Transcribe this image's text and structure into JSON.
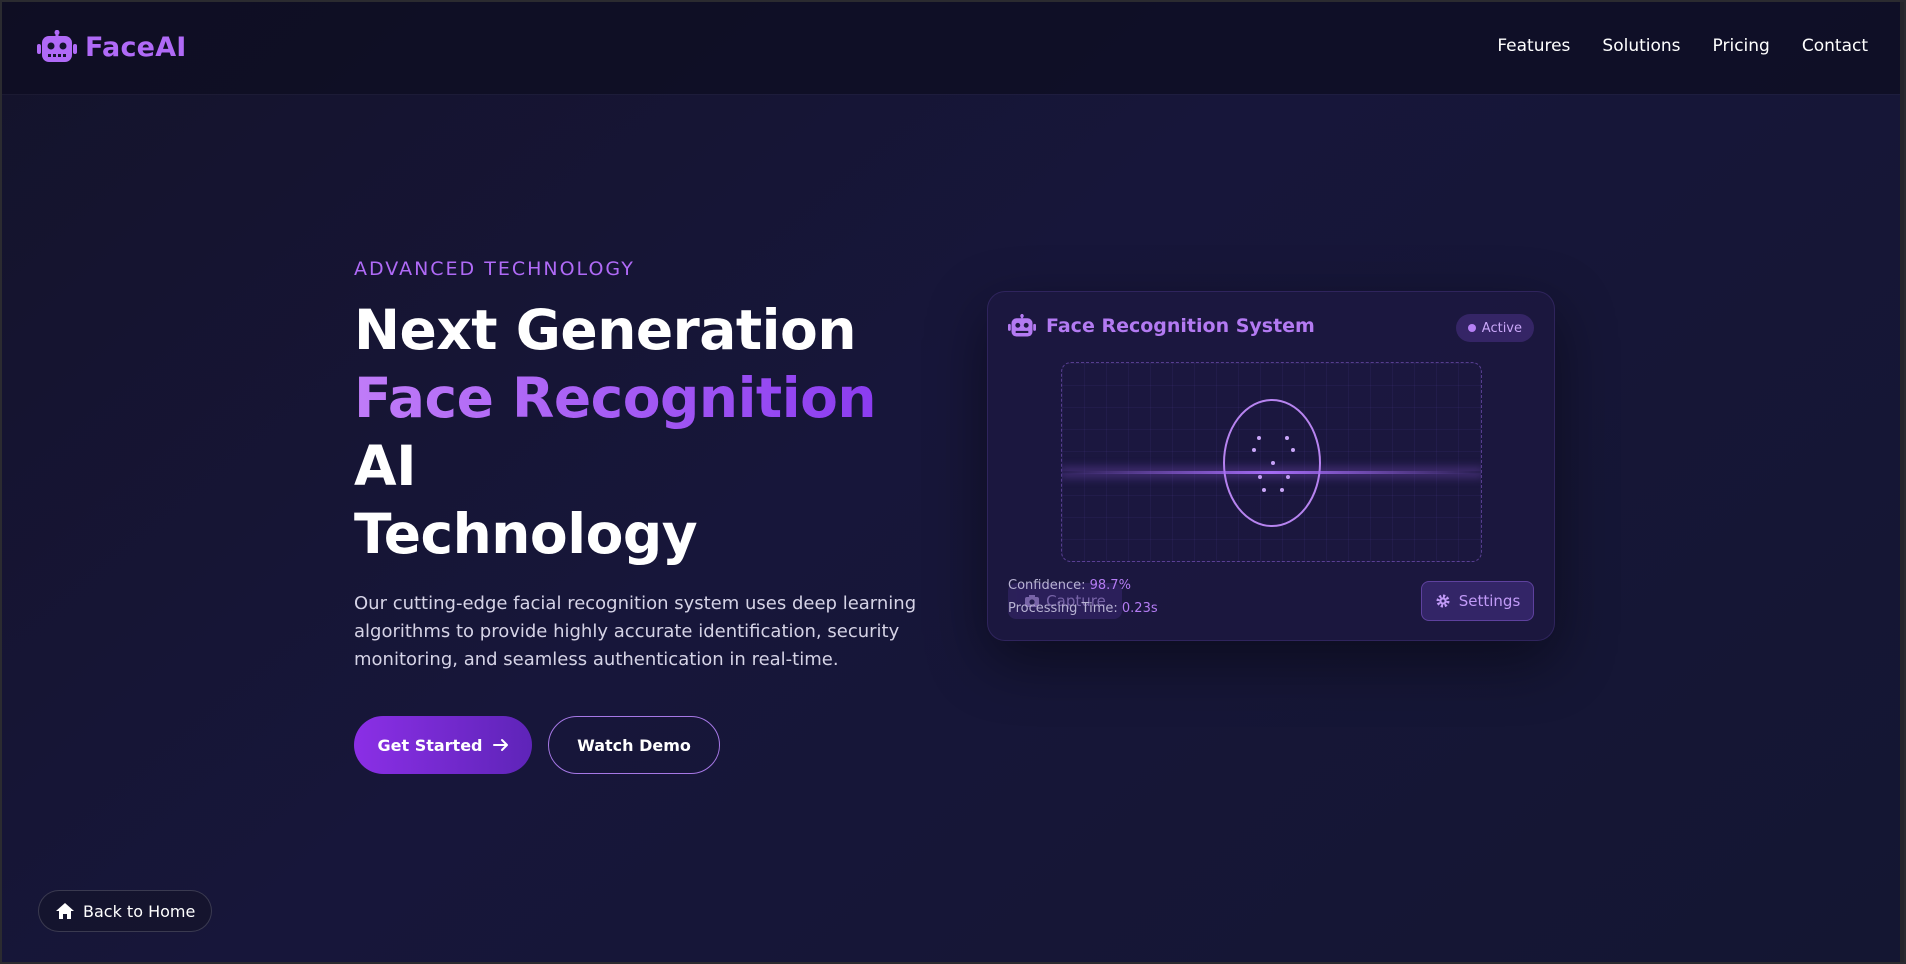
{
  "nav": {
    "brand": "FaceAI",
    "links": [
      "Features",
      "Solutions",
      "Pricing",
      "Contact"
    ]
  },
  "hero": {
    "eyebrow": "ADVANCED TECHNOLOGY",
    "title_line1": "Next Generation",
    "title_accent": "Face Recognition",
    "title_ai": "AI",
    "title_line3": "Technology",
    "description": "Our cutting-edge facial recognition system uses deep learning algorithms to provide highly accurate identification, security monitoring, and seamless authentication in real-time.",
    "primary_label": "Get Started",
    "secondary_label": "Watch Demo"
  },
  "card": {
    "title": "Face Recognition System",
    "status": "Active",
    "confidence_label": "Confidence:",
    "confidence_value": "98.7%",
    "processing_label": "Processing Time:",
    "processing_value": "0.23s",
    "capture_label": "Capture",
    "settings_label": "Settings"
  },
  "footer": {
    "back_label": "Back to Home"
  },
  "icons": {
    "brand": "robot-icon",
    "card": "robot-icon",
    "arrow": "arrow-right-icon",
    "capture": "camera-icon",
    "settings": "gear-icon",
    "home": "home-icon"
  },
  "colors": {
    "accent": "#b06af7",
    "bg": "#15142f",
    "primary_btn": "#7a2ee0"
  }
}
